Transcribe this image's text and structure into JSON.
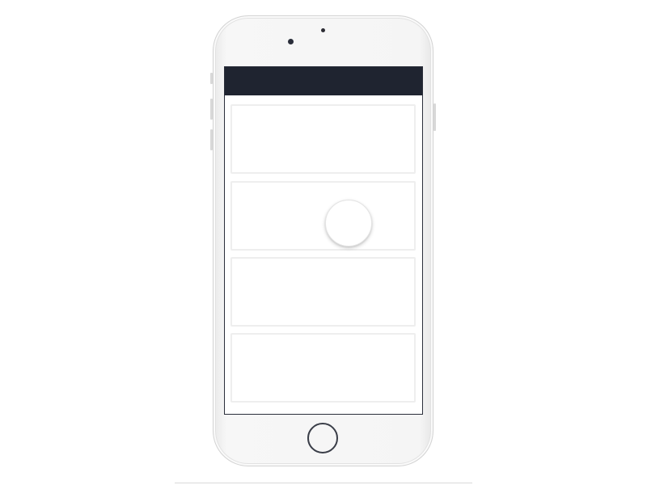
{
  "device": {
    "model": "iphone-white",
    "icons": {
      "front_camera": "camera-icon",
      "speaker": "speaker-icon",
      "home_button": "home-button-icon"
    }
  },
  "app": {
    "app_bar": {
      "title": "",
      "background_color": "#1f2430"
    },
    "cards": [
      {
        "content": ""
      },
      {
        "content": ""
      },
      {
        "content": ""
      },
      {
        "content": ""
      }
    ],
    "touch_indicator": {
      "visible": true,
      "target_card_index": 1
    }
  },
  "colors": {
    "app_bar": "#1f2430",
    "card_border": "#eeeeee",
    "phone_body": "#f5f5f5",
    "screen_background": "#ffffff"
  }
}
